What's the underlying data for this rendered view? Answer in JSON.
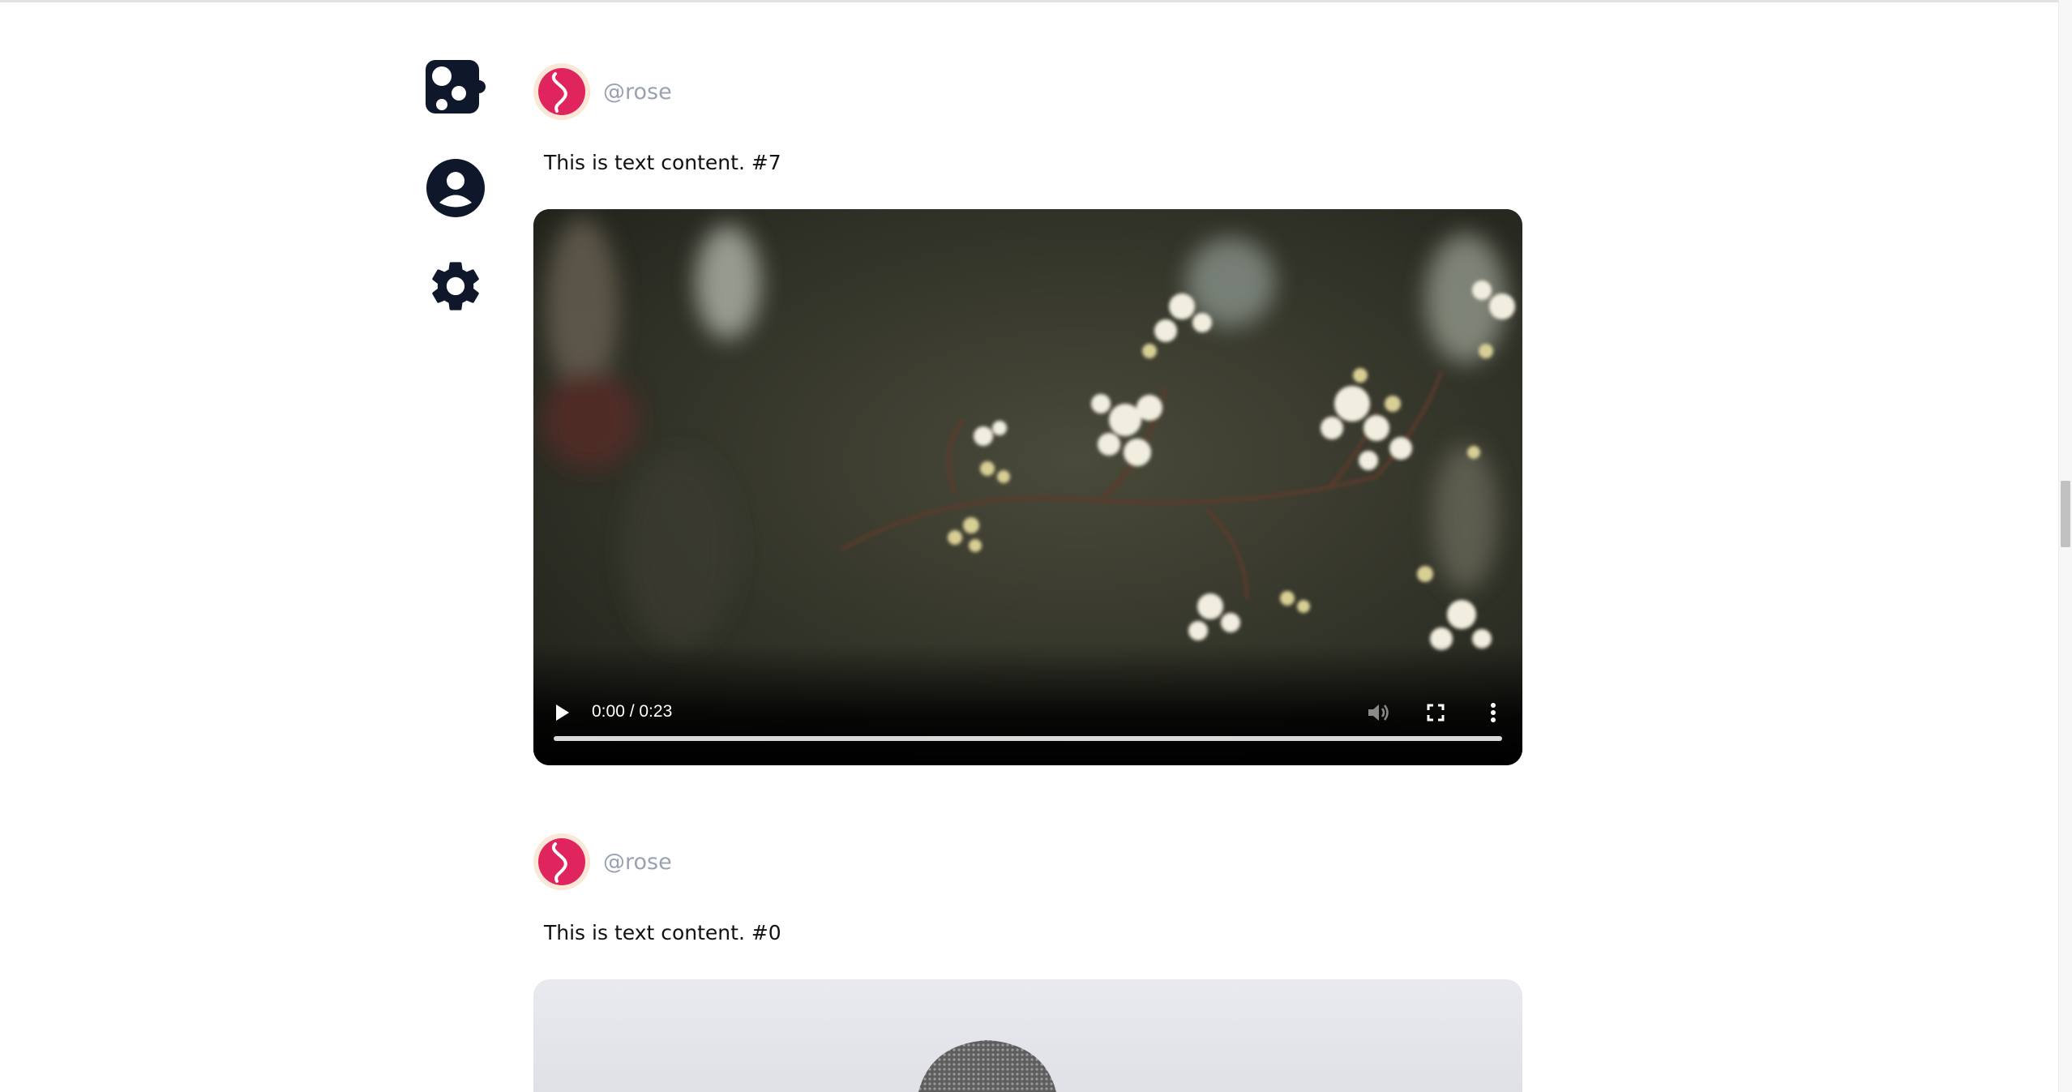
{
  "sidebar": {
    "items": [
      {
        "icon": "dice-icon"
      },
      {
        "icon": "profile-icon"
      },
      {
        "icon": "settings-gear-icon"
      }
    ]
  },
  "posts": [
    {
      "username": "@rose",
      "text": "This is text content. #7",
      "media": {
        "type": "video",
        "time": "0:00 / 0:23",
        "progress": 0
      }
    },
    {
      "username": "@rose",
      "text": "This is text content. #0",
      "media": {
        "type": "image"
      }
    }
  ],
  "colors": {
    "icon": "#0f172a",
    "avatar_bg": "#fbe7d6",
    "avatar_logo": "#e0245e",
    "username": "#9aa2b1"
  }
}
